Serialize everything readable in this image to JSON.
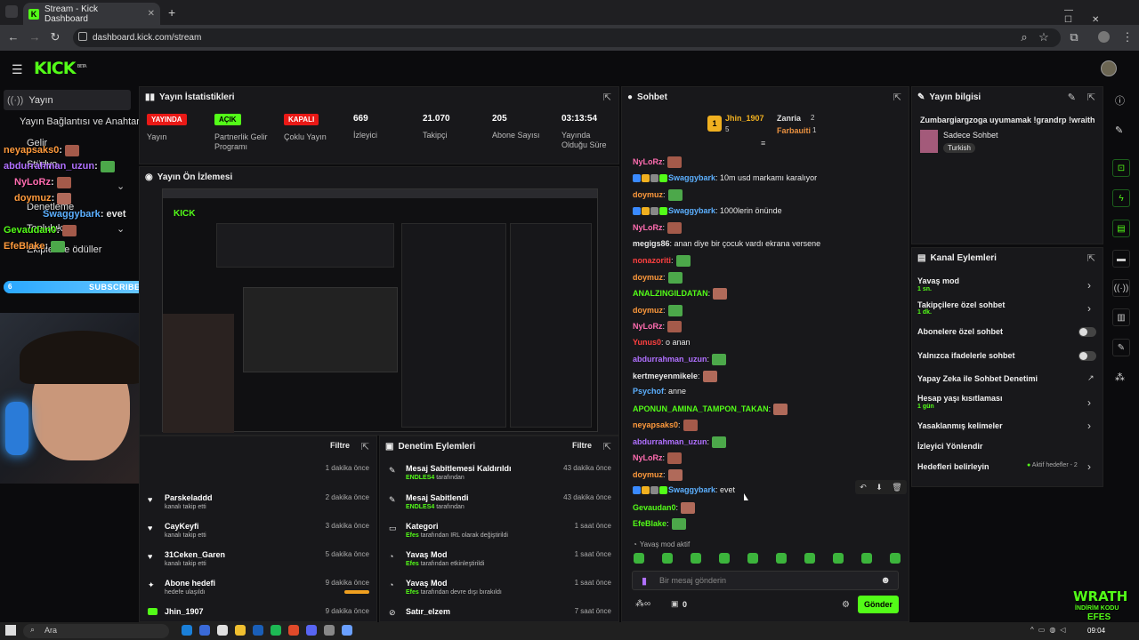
{
  "browser": {
    "tab_title": "Stream - Kick Dashboard",
    "url": "dashboard.kick.com/stream"
  },
  "kick": {
    "logo": "KICK",
    "beta": "BETA"
  },
  "sidebar": {
    "items": [
      {
        "label": "Yayın"
      },
      {
        "label": "Yayın Bağlantısı ve Anahtarı"
      },
      {
        "label": "Gelir"
      },
      {
        "label": "Stüdyo"
      },
      {
        "label": "Denetleme"
      },
      {
        "label": "Topluluk"
      },
      {
        "label": "Ekipler ve ödüller"
      }
    ]
  },
  "overlay_chat": [
    {
      "user": "neyapsaks0",
      "text": ":"
    },
    {
      "user": "abdurrahman_uzun",
      "text": ":"
    },
    {
      "user": "NyLoRz",
      "text": ":"
    },
    {
      "user": "doymuz",
      "text": ":"
    },
    {
      "user": "Swaggybark",
      "text": ": evet"
    },
    {
      "user": "Gevaudan0",
      "text": ":"
    },
    {
      "user": "EfeBlake",
      "text": ":"
    }
  ],
  "subs_bar": {
    "left": "6",
    "label": "SUBSCRIBERS",
    "right": "7",
    "fill": 0.82
  },
  "stats": {
    "title": "Yayın İstatistikleri",
    "cols": [
      {
        "badge": "YAYINDA",
        "label": "Yayın"
      },
      {
        "badge": "AÇIK",
        "label": "Partnerlik Gelir Programı"
      },
      {
        "badge": "KAPALI",
        "label": "Çoklu Yayın"
      },
      {
        "value": "669",
        "label": "İzleyici"
      },
      {
        "value": "21.070",
        "label": "Takipçi"
      },
      {
        "value": "205",
        "label": "Abone Sayısı"
      },
      {
        "value": "03:13:54",
        "label": "Yayında Olduğu Süre"
      }
    ]
  },
  "preview": {
    "title": "Yayın Ön İzlemesi"
  },
  "activity": {
    "filter": "Filtre",
    "items": [
      {
        "title": "",
        "sub": "",
        "time": "1 dakika önce"
      },
      {
        "title": "Parskeladdd",
        "sub": "kanalı takip etti",
        "time": "2 dakika önce"
      },
      {
        "title": "CayKeyfi",
        "sub": "kanalı takip etti",
        "time": "3 dakika önce"
      },
      {
        "title": "31Ceken_Garen",
        "sub": "kanalı takip etti",
        "time": "5 dakika önce"
      },
      {
        "title": "Abone hedefi",
        "sub": "hedefe ulaşıldı",
        "time": "9 dakika önce"
      },
      {
        "title": "Jhin_1907",
        "sub": "",
        "time": "9 dakika önce"
      }
    ]
  },
  "mod": {
    "title": "Denetim Eylemleri",
    "filter": "Filtre",
    "items": [
      {
        "title": "Mesaj Sabitlemesi Kaldırıldı",
        "actor": "ENDLES4",
        "rest": " tarafından",
        "time": "43 dakika önce"
      },
      {
        "title": "Mesaj Sabitlendi",
        "actor": "ENDLES4",
        "rest": " tarafından",
        "time": "43 dakika önce"
      },
      {
        "title": "Kategori",
        "actor": "Efes",
        "rest": " tarafından IRL olarak değiştirildi",
        "time": "1 saat önce"
      },
      {
        "title": "Yavaş Mod",
        "actor": "Efes",
        "rest": " tarafından etkinleştirildi",
        "time": "1 saat önce"
      },
      {
        "title": "Yavaş Mod",
        "actor": "Efes",
        "rest": " tarafından devre dışı bırakıldı",
        "time": "1 saat önce"
      },
      {
        "title": "Satır_elzem",
        "actor": "",
        "rest": "",
        "time": "7 saat önce"
      }
    ]
  },
  "chat": {
    "title": "Sohbet",
    "top": [
      {
        "name": "Jhin_1907",
        "count": "5"
      },
      {
        "name": "Zanria",
        "count": "2"
      },
      {
        "name": "Farbauiti",
        "count": "1"
      }
    ],
    "messages": [
      {
        "user": "NyLoRz",
        "color": "#ff6cb0",
        "text": ":",
        "emote": "r",
        "badges": 0
      },
      {
        "user": "Swaggybark",
        "color": "#5cb0ff",
        "text": ": 10m usd markamı karalıyor",
        "emote": "",
        "badges": 1
      },
      {
        "user": "doymuz",
        "color": "#ff9a3c",
        "text": ":",
        "emote": "g",
        "badges": 0
      },
      {
        "user": "Swaggybark",
        "color": "#5cb0ff",
        "text": ": 1000lerin önünde",
        "emote": "",
        "badges": 1
      },
      {
        "user": "NyLoRz",
        "color": "#ff6cb0",
        "text": ":",
        "emote": "r",
        "badges": 0
      },
      {
        "user": "megigs86",
        "color": "#e8e8e8",
        "text": ": anan diye bir çocuk vardı ekrana versene",
        "emote": "",
        "badges": 0
      },
      {
        "user": "nonazoriti",
        "color": "#ff4040",
        "text": ":",
        "emote": "g",
        "badges": 0
      },
      {
        "user": "doymuz",
        "color": "#ff9a3c",
        "text": ":",
        "emote": "g",
        "badges": 0
      },
      {
        "user": "ANALZINGILDATAN",
        "color": "#53fc18",
        "text": ":",
        "emote": "p",
        "badges": 0
      },
      {
        "user": "doymuz",
        "color": "#ff9a3c",
        "text": ":",
        "emote": "g",
        "badges": 0
      },
      {
        "user": "NyLoRz",
        "color": "#ff6cb0",
        "text": ":",
        "emote": "r",
        "badges": 0
      },
      {
        "user": "Yunus0",
        "color": "#ff4040",
        "text": ": o anan",
        "emote": "",
        "badges": 0
      },
      {
        "user": "abdurrahman_uzun",
        "color": "#b070ff",
        "text": ":",
        "emote": "g",
        "badges": 0
      },
      {
        "user": "kertmeyenmikele",
        "color": "#e8e8e8",
        "text": ":",
        "emote": "p",
        "badges": 0
      },
      {
        "user": "Psychof",
        "color": "#5cb0ff",
        "text": ": anne",
        "emote": "",
        "badges": 0
      },
      {
        "user": "APONUN_AMINA_TAMPON_TAKAN",
        "color": "#53fc18",
        "text": ":",
        "emote": "p",
        "badges": 0
      },
      {
        "user": "neyapsaks0",
        "color": "#ff9a3c",
        "text": ":",
        "emote": "r",
        "badges": 0
      },
      {
        "user": "abdurrahman_uzun",
        "color": "#b070ff",
        "text": ":",
        "emote": "g",
        "badges": 0
      },
      {
        "user": "NyLoRz",
        "color": "#ff6cb0",
        "text": ":",
        "emote": "r",
        "badges": 0
      },
      {
        "user": "doymuz",
        "color": "#ff9a3c",
        "text": ":",
        "emote": "p",
        "badges": 0
      },
      {
        "user": "Swaggybark",
        "color": "#5cb0ff",
        "text": ": evet",
        "emote": "",
        "badges": 1
      },
      {
        "user": "Gevaudan0",
        "color": "#53fc18",
        "text": ":",
        "emote": "p",
        "badges": 0
      },
      {
        "user": "EfeBlake",
        "color": "#53fc18",
        "text": ":",
        "emote": "g",
        "badges": 0
      }
    ],
    "slow_mode": "Yavaş mod aktif",
    "placeholder": "Bir mesaj gönderin",
    "points": "0",
    "send": "Gönder"
  },
  "info": {
    "title": "Yayın bilgisi",
    "stream_title": "Zumbargiargzoga uyumamak !grandrp !wraith",
    "category": "Sadece Sohbet",
    "language": "Turkish"
  },
  "actions": {
    "title": "Kanal Eylemleri",
    "items": [
      {
        "label": "Yavaş mod",
        "sub": "1 sn.",
        "ctl": "chev"
      },
      {
        "label": "Takipçilere özel sohbet",
        "sub": "1 dk.",
        "ctl": "chev"
      },
      {
        "label": "Abonelere özel sohbet",
        "sub": "",
        "ctl": "toggle"
      },
      {
        "label": "Yalnızca ifadelerle sohbet",
        "sub": "",
        "ctl": "toggle"
      },
      {
        "label": "Yapay Zeka ile Sohbet Denetimi",
        "sub": "",
        "ctl": "ext"
      },
      {
        "label": "Hesap yaşı kısıtlaması",
        "sub": "1 gün",
        "ctl": "chev"
      },
      {
        "label": "Yasaklanmış kelimeler",
        "sub": "",
        "ctl": "chev"
      },
      {
        "label": "İzleyici Yönlendir",
        "sub": "",
        "ctl": "none"
      },
      {
        "label": "Hedefleri belirleyin",
        "sub": "",
        "ctl": "chev"
      }
    ],
    "goals_active": "Aktif hedefler - 2"
  },
  "overlay": {
    "brand": "WRATH",
    "sub": "İNDİRİM KODU",
    "sub2": "EFES"
  },
  "taskbar": {
    "search": "Ara",
    "time": "09:04"
  }
}
